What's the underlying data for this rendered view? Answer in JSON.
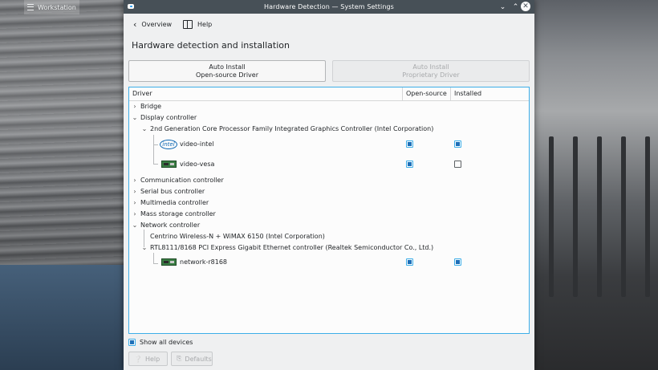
{
  "desktop": {
    "task_button_label": "Workstation"
  },
  "window": {
    "title": "Hardware Detection  — System Settings",
    "minimize_glyph": "⌄",
    "maximize_glyph": "⌃",
    "close_glyph": "✕"
  },
  "toolbar": {
    "overview_label": "Overview",
    "help_label": "Help"
  },
  "page": {
    "title": "Hardware detection and installation"
  },
  "actions": {
    "oss_line1": "Auto Install",
    "oss_line2": "Open-source Driver",
    "prop_line1": "Auto Install",
    "prop_line2": "Proprietary Driver"
  },
  "table": {
    "columns": [
      "Driver",
      "Open-source",
      "Installed"
    ],
    "rows": [
      {
        "label": "Bridge",
        "arrow": "›"
      },
      {
        "label": "Display controller",
        "arrow": "⌄"
      },
      {
        "label": "2nd Generation Core Processor Family Integrated Graphics Controller (Intel Corporation)",
        "arrow": "⌄"
      },
      {
        "label": "video-intel",
        "icon": "intel",
        "open_source": true,
        "installed": true
      },
      {
        "label": "video-vesa",
        "icon": "card-icon",
        "open_source": true,
        "installed": false
      },
      {
        "label": "Communication controller",
        "arrow": "›"
      },
      {
        "label": "Serial bus controller",
        "arrow": "›"
      },
      {
        "label": "Multimedia controller",
        "arrow": "›"
      },
      {
        "label": "Mass storage controller",
        "arrow": "›"
      },
      {
        "label": "Network controller",
        "arrow": "⌄"
      },
      {
        "label": "Centrino Wireless-N + WiMAX 6150 (Intel Corporation)"
      },
      {
        "label": "RTL8111/8168 PCI Express Gigabit Ethernet controller (Realtek Semiconductor Co., Ltd.)",
        "arrow": "⌄"
      },
      {
        "label": "network-r8168",
        "icon": "card-icon",
        "open_source": true,
        "installed": true
      }
    ]
  },
  "footer": {
    "show_all_label": "Show all devices",
    "show_all_checked": true,
    "help_label": "Help",
    "defaults_label": "Defaults"
  },
  "colors": {
    "accent": "#3daee9",
    "titlebar": "#475057",
    "check_fill": "#1d6fb8"
  }
}
